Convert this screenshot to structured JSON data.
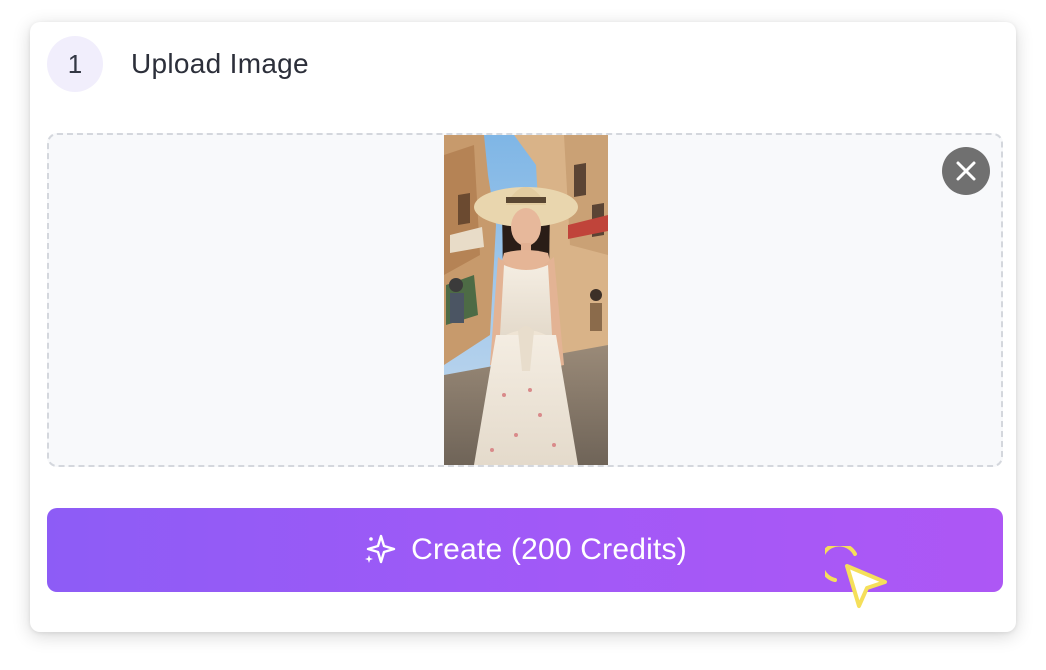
{
  "step": {
    "number": "1",
    "title": "Upload Image"
  },
  "upload": {
    "remove_icon": "close-icon"
  },
  "create_button": {
    "label": "Create (200 Credits)",
    "icon": "sparkle-icon"
  },
  "colors": {
    "accent_start": "#8d5cf6",
    "accent_end": "#ad57f5",
    "badge_bg": "#f1eefc",
    "cursor": "#f5df5a"
  }
}
